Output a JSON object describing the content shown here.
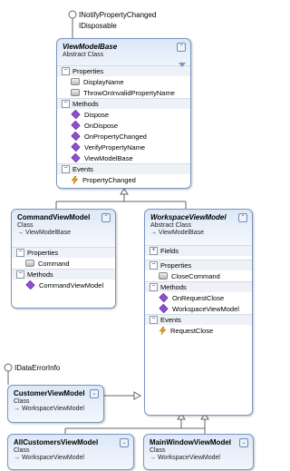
{
  "iface_top": [
    "INotifyPropertyChanged",
    "IDisposable"
  ],
  "viewmodelbase": {
    "name": "ViewModelBase",
    "kind": "Abstract Class",
    "properties_label": "Properties",
    "properties": [
      "DisplayName",
      "ThrowOnInvalidPropertyName"
    ],
    "methods_label": "Methods",
    "methods": [
      "Dispose",
      "OnDispose",
      "OnPropertyChanged",
      "VerifyPropertyName",
      "ViewModelBase"
    ],
    "events_label": "Events",
    "events": [
      "PropertyChanged"
    ]
  },
  "commandviewmodel": {
    "name": "CommandViewModel",
    "kind": "Class",
    "base": "→ ViewModelBase",
    "properties_label": "Properties",
    "properties": [
      "Command"
    ],
    "methods_label": "Methods",
    "methods": [
      "CommandViewModel"
    ]
  },
  "workspaceviewmodel": {
    "name": "WorkspaceViewModel",
    "kind": "Abstract Class",
    "base": "→ ViewModelBase",
    "fields_label": "Fields",
    "properties_label": "Properties",
    "properties": [
      "CloseCommand"
    ],
    "methods_label": "Methods",
    "methods": [
      "OnRequestClose",
      "WorkspaceViewModel"
    ],
    "events_label": "Events",
    "events": [
      "RequestClose"
    ]
  },
  "iface_customer": "IDataErrorInfo",
  "customerviewmodel": {
    "name": "CustomerViewModel",
    "kind": "Class",
    "base": "→ WorkspaceViewModel"
  },
  "allcustomersviewmodel": {
    "name": "AllCustomersViewModel",
    "kind": "Class",
    "base": "→ WorkspaceViewModel"
  },
  "mainwindowviewmodel": {
    "name": "MainWindowViewModel",
    "kind": "Class",
    "base": "→ WorkspaceViewModel"
  },
  "colors": {
    "border": "#7a96c0",
    "header": "#dce8f8",
    "method": "#8f4fd0",
    "event": "#e0a020"
  },
  "icons": {
    "collapse": "double-chevron-up-icon",
    "expand": "double-chevron-down-icon",
    "filter": "filter-icon"
  }
}
